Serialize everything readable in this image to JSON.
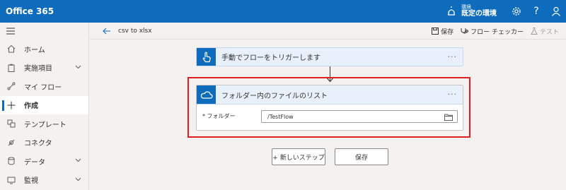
{
  "app": {
    "title": "Office 365"
  },
  "header": {
    "env_label": "環境",
    "env_name": "既定の環境"
  },
  "sidebar": {
    "items": [
      {
        "label": "ホーム"
      },
      {
        "label": "実施項目"
      },
      {
        "label": "マイ フロー"
      },
      {
        "label": "作成"
      },
      {
        "label": "テンプレート"
      },
      {
        "label": "コネクタ"
      },
      {
        "label": "データ"
      },
      {
        "label": "監視"
      }
    ]
  },
  "commandbar": {
    "flow_name": "csv to xlsx",
    "save": "保存",
    "flow_checker": "フロー チェッカー",
    "test": "テスト"
  },
  "trigger": {
    "title": "手動でフローをトリガーします",
    "more": "···"
  },
  "action": {
    "title": "フォルダー内のファイルのリスト",
    "more": "···",
    "field_label": "* フォルダー",
    "field_value": "/TestFlow"
  },
  "buttons": {
    "new_step": "+ 新しいステップ",
    "save": "保存"
  },
  "colors": {
    "brand": "#0f6cbd",
    "highlight": "#e02020",
    "card_header": "#e8f1fb"
  }
}
